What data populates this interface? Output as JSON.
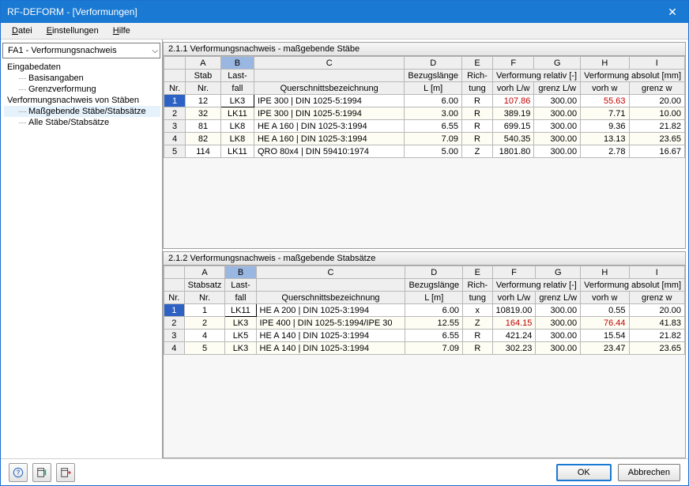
{
  "window": {
    "title": "RF-DEFORM - [Verformungen]"
  },
  "menu": {
    "datei": "Datei",
    "einstellungen": "Einstellungen",
    "hilfe": "Hilfe"
  },
  "sidebar": {
    "combo": "FA1 - Verformungsnachweis",
    "nodes": [
      {
        "label": "Eingabedaten",
        "lvl": 1
      },
      {
        "label": "Basisangaben",
        "lvl": 2
      },
      {
        "label": "Grenzverformung",
        "lvl": 2
      },
      {
        "label": "Verformungsnachweis von Stäben",
        "lvl": 1
      },
      {
        "label": "Maßgebende Stäbe/Stabsätze",
        "lvl": 2,
        "sel": true
      },
      {
        "label": "Alle Stäbe/Stabsätze",
        "lvl": 2
      }
    ]
  },
  "panel1": {
    "title": "2.1.1 Verformungsnachweis - maßgebende Stäbe",
    "cols": {
      "letters": [
        "",
        "A",
        "B",
        "C",
        "D",
        "E",
        "F",
        "G",
        "H",
        "I"
      ],
      "group": {
        "nr": "Nr.",
        "stabnr": "Stab\nNr.",
        "lastfall": "Last-\nfall",
        "bez": "Querschnittsbezeichnung",
        "bezugsl": "Bezugslänge\nL [m]",
        "richtung": "Rich-\ntung",
        "verfrel": "Verformung relativ [-]",
        "vorhlw": "vorh L/w",
        "grenzlw": "grenz  L/w",
        "verfabs": "Verformung absolut [mm]",
        "vorhw": "vorh w",
        "grenzw": "grenz w"
      }
    },
    "rows": [
      {
        "nr": "1",
        "stab": "12",
        "last": "LK3",
        "bez": "IPE 300 | DIN 1025-5:1994",
        "L": "6.00",
        "rt": "R",
        "vorhLw": "107.86",
        "vorhLw_red": true,
        "grenzLw": "300.00",
        "vorhW": "55.63",
        "vorhW_red": true,
        "grenzW": "20.00",
        "sel": true
      },
      {
        "nr": "2",
        "stab": "32",
        "last": "LK11",
        "bez": "IPE 300 | DIN 1025-5:1994",
        "L": "3.00",
        "rt": "R",
        "vorhLw": "389.19",
        "grenzLw": "300.00",
        "vorhW": "7.71",
        "grenzW": "10.00"
      },
      {
        "nr": "3",
        "stab": "81",
        "last": "LK8",
        "bez": "HE A 160 | DIN 1025-3:1994",
        "L": "6.55",
        "rt": "R",
        "vorhLw": "699.15",
        "grenzLw": "300.00",
        "vorhW": "9.36",
        "grenzW": "21.82"
      },
      {
        "nr": "4",
        "stab": "82",
        "last": "LK8",
        "bez": "HE A 160 | DIN 1025-3:1994",
        "L": "7.09",
        "rt": "R",
        "vorhLw": "540.35",
        "grenzLw": "300.00",
        "vorhW": "13.13",
        "grenzW": "23.65"
      },
      {
        "nr": "5",
        "stab": "114",
        "last": "LK11",
        "bez": "QRO 80x4 | DIN 59410:1974",
        "L": "5.00",
        "rt": "Z",
        "vorhLw": "1801.80",
        "grenzLw": "300.00",
        "vorhW": "2.78",
        "grenzW": "16.67"
      }
    ]
  },
  "panel2": {
    "title": "2.1.2 Verformungsnachweis - maßgebende Stabsätze",
    "cols": {
      "stabsatz": "Stabsatz\nNr."
    },
    "rows": [
      {
        "nr": "1",
        "set": "1",
        "last": "LK11",
        "bez": "HE A 200 | DIN 1025-3:1994",
        "L": "6.00",
        "rt": "x",
        "vorhLw": "10819.00",
        "grenzLw": "300.00",
        "vorhW": "0.55",
        "grenzW": "20.00",
        "sel": true
      },
      {
        "nr": "2",
        "set": "2",
        "last": "LK3",
        "bez": "IPE 400 | DIN 1025-5:1994/IPE 30",
        "L": "12.55",
        "rt": "Z",
        "vorhLw": "164.15",
        "vorhLw_red": true,
        "grenzLw": "300.00",
        "vorhW": "76.44",
        "vorhW_red": true,
        "grenzW": "41.83"
      },
      {
        "nr": "3",
        "set": "4",
        "last": "LK5",
        "bez": "HE A 140 | DIN 1025-3:1994",
        "L": "6.55",
        "rt": "R",
        "vorhLw": "421.24",
        "grenzLw": "300.00",
        "vorhW": "15.54",
        "grenzW": "21.82"
      },
      {
        "nr": "4",
        "set": "5",
        "last": "LK3",
        "bez": "HE A 140 | DIN 1025-3:1994",
        "L": "7.09",
        "rt": "R",
        "vorhLw": "302.23",
        "grenzLw": "300.00",
        "vorhW": "23.47",
        "grenzW": "23.65"
      }
    ]
  },
  "footer": {
    "ok": "OK",
    "cancel": "Abbrechen"
  },
  "icons": {
    "help": "help-icon",
    "calc": "calc-icon",
    "export": "export-icon",
    "chev": "chevron-down-icon",
    "close": "close-icon"
  }
}
